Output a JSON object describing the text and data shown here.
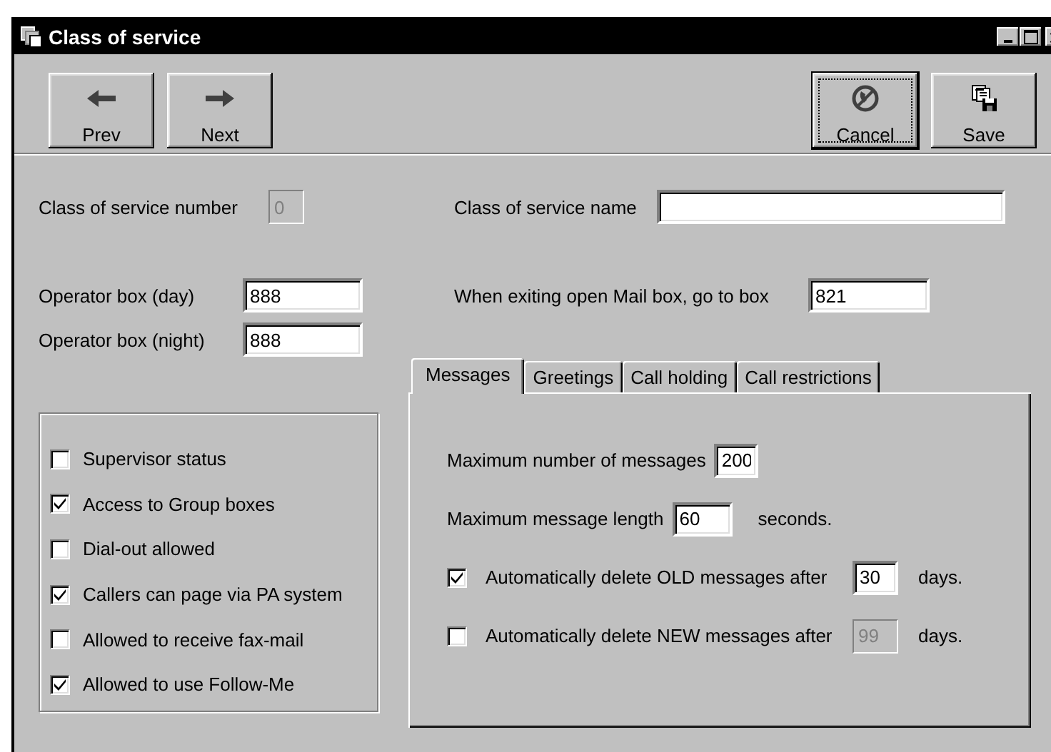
{
  "window": {
    "title": "Class of service"
  },
  "toolbar": {
    "left": [
      {
        "label": "Prev",
        "kind": "prev",
        "default": false
      },
      {
        "label": "Next",
        "kind": "next",
        "default": false
      }
    ],
    "right": [
      {
        "label": "Cancel",
        "kind": "cancel",
        "default": true
      },
      {
        "label": "Save",
        "kind": "save",
        "default": false
      }
    ]
  },
  "class_number": {
    "label": "Class of service number",
    "value": "0",
    "disabled": true
  },
  "class_name": {
    "label": "Class of service name",
    "disabled": false
  },
  "operator_day": {
    "label": "Operator box (day)",
    "value": "888",
    "disabled": false
  },
  "operator_night": {
    "label": "Operator box (night)",
    "value": "888",
    "disabled": false
  },
  "exit_box": {
    "label": "When exiting open Mail box, go to box",
    "value": "821",
    "disabled": false
  },
  "permissions": [
    {
      "label": "Supervisor status",
      "checked": false
    },
    {
      "label": "Access to Group boxes",
      "checked": true
    },
    {
      "label": "Dial-out allowed",
      "checked": false
    },
    {
      "label": "Callers can page via PA system",
      "checked": true
    },
    {
      "label": "Allowed to receive fax-mail",
      "checked": false
    },
    {
      "label": "Allowed to use Follow-Me",
      "checked": true
    }
  ],
  "tabs": [
    {
      "label": "Messages",
      "selected": true
    },
    {
      "label": "Greetings",
      "selected": false
    },
    {
      "label": "Call holding",
      "selected": false
    },
    {
      "label": "Call restrictions",
      "selected": false
    }
  ],
  "messages_tab": [
    {
      "kind": "field",
      "label": "Maximum number of messages",
      "value": "200",
      "disabled": false
    },
    {
      "kind": "field",
      "label": "Maximum message length",
      "value": "60",
      "unit": "seconds.",
      "disabled": false
    },
    {
      "kind": "check",
      "label": "Automatically delete OLD messages after",
      "checked": true,
      "value": "30",
      "unit": "days.",
      "disabled": false
    },
    {
      "kind": "check",
      "label": "Automatically delete NEW messages after",
      "checked": false,
      "value": "99",
      "unit": "days.",
      "disabled": true
    }
  ]
}
